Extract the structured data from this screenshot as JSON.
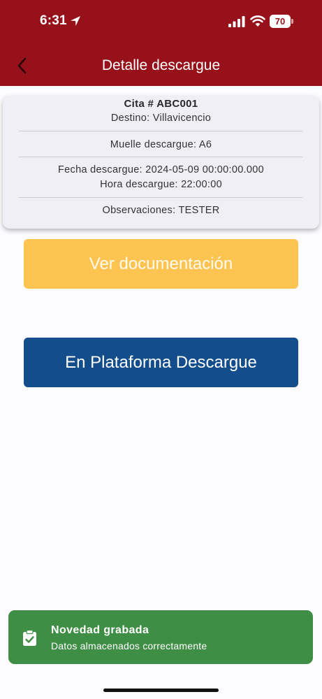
{
  "status_bar": {
    "time": "6:31",
    "battery_level": "70",
    "icons": [
      "location-arrow-icon",
      "signal-icon",
      "wifi-icon",
      "battery-icon"
    ]
  },
  "header": {
    "title": "Detalle descargue",
    "back_icon": "chevron-left-icon",
    "background_color": "#97111b"
  },
  "card": {
    "title": "Cita # ABC001",
    "destino": "Destino: Villavicencio",
    "muelle": "Muelle descargue: A6",
    "fecha": "Fecha descargue: 2024-05-09 00:00:00.000",
    "hora": "Hora descargue: 22:00:00",
    "observaciones": "Observaciones: TESTER"
  },
  "buttons": {
    "docs_label": "Ver documentación",
    "docs_color": "#fec451",
    "platform_label": "En Plataforma Descargue",
    "platform_color": "#134d8c"
  },
  "toast": {
    "title": "Novedad grabada",
    "message": "Datos almacenados correctamente",
    "icon": "clipboard-check-icon",
    "color": "#3f8e45"
  }
}
